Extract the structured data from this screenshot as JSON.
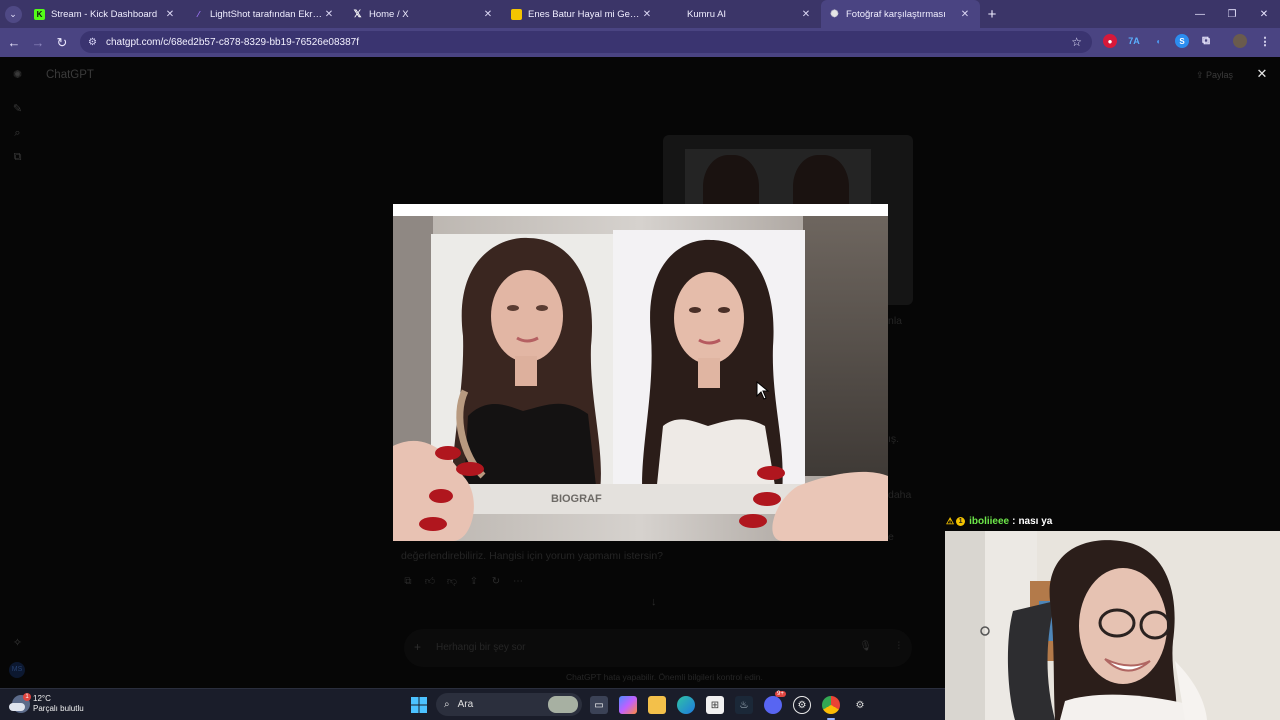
{
  "browser": {
    "tabs": [
      {
        "title": "Stream - Kick Dashboard",
        "favicon": "kick-icon",
        "favicon_color": "#53fc18"
      },
      {
        "title": "LightShot tarafından Ekran Gön",
        "favicon": "feather-icon",
        "favicon_color": "#a277ff"
      },
      {
        "title": "Home / X",
        "favicon": "x-icon",
        "favicon_color": "#ffffff"
      },
      {
        "title": "Enes Batur Hayal mi Gerçek Mi",
        "favicon": "film-icon",
        "favicon_color": "#f5c400"
      },
      {
        "title": "Kumru AI",
        "favicon": "blank-icon",
        "favicon_color": "#3b3568"
      },
      {
        "title": "Fotoğraf karşılaştırması",
        "favicon": "openai-icon",
        "favicon_color": "#e6e6e6",
        "active": true
      }
    ],
    "url": "chatgpt.com/c/68ed2b57-c878-8329-bb19-76526e08387f"
  },
  "chatgpt": {
    "brand": "ChatGPT",
    "share_label": "Paylaş",
    "ghost_texts": {
      "line1": "nla",
      "line2": "ış.",
      "line3": "daha",
      "line4": "e",
      "answer_tail": "değerlendirebiliriz. Hangisi için yorum yapmamı istersin?"
    },
    "composer_placeholder": "Herhangi bir şey sor",
    "disclaimer": "ChatGPT hata yapabilir. Önemli bilgileri kontrol edin.",
    "user_initials": "MS"
  },
  "taskbar": {
    "weather_temp": "12°C",
    "weather_desc": "Parçalı bulutlu",
    "weather_badge": "1",
    "search_label": "Ara",
    "discord_badge": "9+"
  },
  "overlay": {
    "chat_username": "iboliieee",
    "chat_message": "nası ya",
    "mod_badge": "1"
  },
  "colors": {
    "tabbar": "#3b3568",
    "addressbar": "#4a4482",
    "page_bg": "#060606",
    "taskbar": "#1a1d2a",
    "chat_username": "#6ee84a"
  }
}
